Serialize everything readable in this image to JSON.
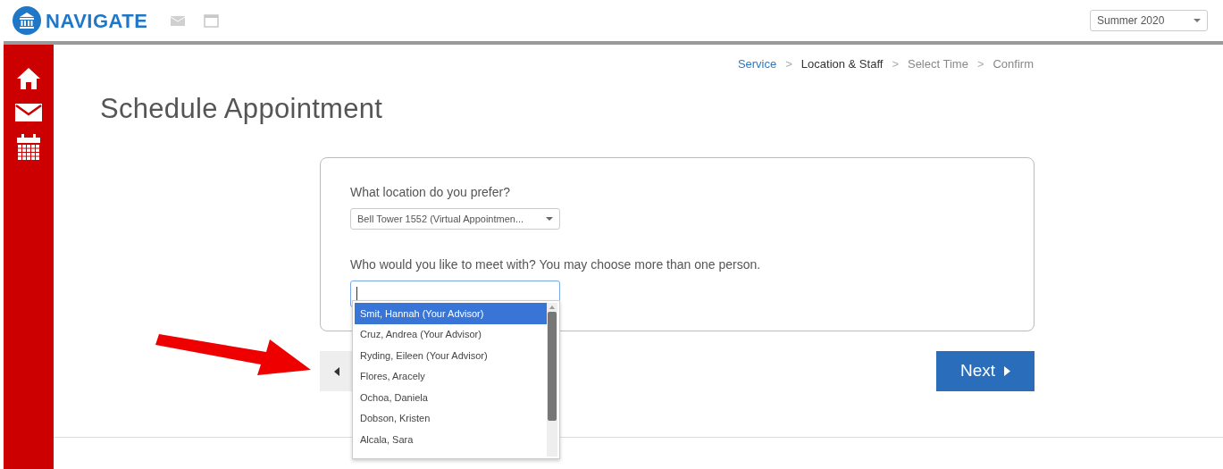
{
  "header": {
    "logo": "NAVIGATE",
    "term": "Summer 2020"
  },
  "sidebar": [
    {
      "kind": "home"
    },
    {
      "kind": "mail"
    },
    {
      "kind": "calendar"
    }
  ],
  "breadcrumb": [
    {
      "label": "Service",
      "selected": false,
      "completed": true
    },
    {
      "label": "Location & Staff",
      "selected": true,
      "completed": false
    },
    {
      "label": "Select Time",
      "selected": false,
      "completed": false
    },
    {
      "label": "Confirm",
      "selected": false,
      "completed": false
    }
  ],
  "separator": ">",
  "title": "Schedule Appointment",
  "location": {
    "label": "What location do you prefer?",
    "value": "Bell Tower 1552 (Virtual Appointmen..."
  },
  "staff": {
    "label": "Who would you like to meet with? You may choose more than one person.",
    "options": [
      {
        "label": "Smit, Hannah (Your Advisor)",
        "selected": true
      },
      {
        "label": "Cruz, Andrea (Your Advisor)",
        "selected": false
      },
      {
        "label": "Ryding, Eileen (Your Advisor)",
        "selected": false
      },
      {
        "label": "Flores, Aracely",
        "selected": false
      },
      {
        "label": "Ochoa, Daniela",
        "selected": false
      },
      {
        "label": "Dobson, Kristen",
        "selected": false
      },
      {
        "label": "Alcala, Sara",
        "selected": false
      }
    ]
  },
  "next_button": "Next"
}
